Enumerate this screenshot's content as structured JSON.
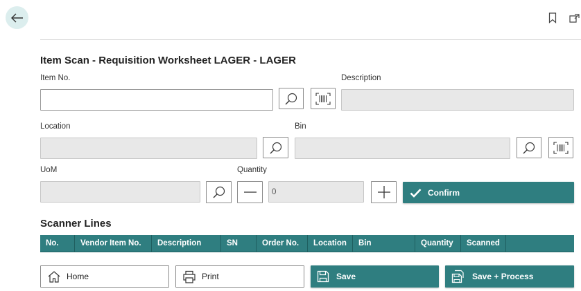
{
  "form": {
    "title": "Item Scan - Requisition Worksheet LAGER - LAGER",
    "item_no": {
      "label": "Item No.",
      "value": ""
    },
    "description": {
      "label": "Description",
      "value": ""
    },
    "location": {
      "label": "Location",
      "value": ""
    },
    "bin": {
      "label": "Bin",
      "value": ""
    },
    "uom": {
      "label": "UoM",
      "value": ""
    },
    "quantity": {
      "label": "Quantity",
      "value": "0"
    },
    "confirm_label": "Confirm"
  },
  "scanner_lines": {
    "title": "Scanner Lines",
    "columns": [
      "No.",
      "Vendor Item No.",
      "Description",
      "SN",
      "Order No.",
      "Location",
      "Bin",
      "Quantity",
      "Scanned"
    ]
  },
  "actions": {
    "home": "Home",
    "print": "Print",
    "save": "Save",
    "save_process": "Save + Process"
  },
  "colors": {
    "accent": "#2f7e80",
    "disabled_field": "#e8e8e8"
  }
}
